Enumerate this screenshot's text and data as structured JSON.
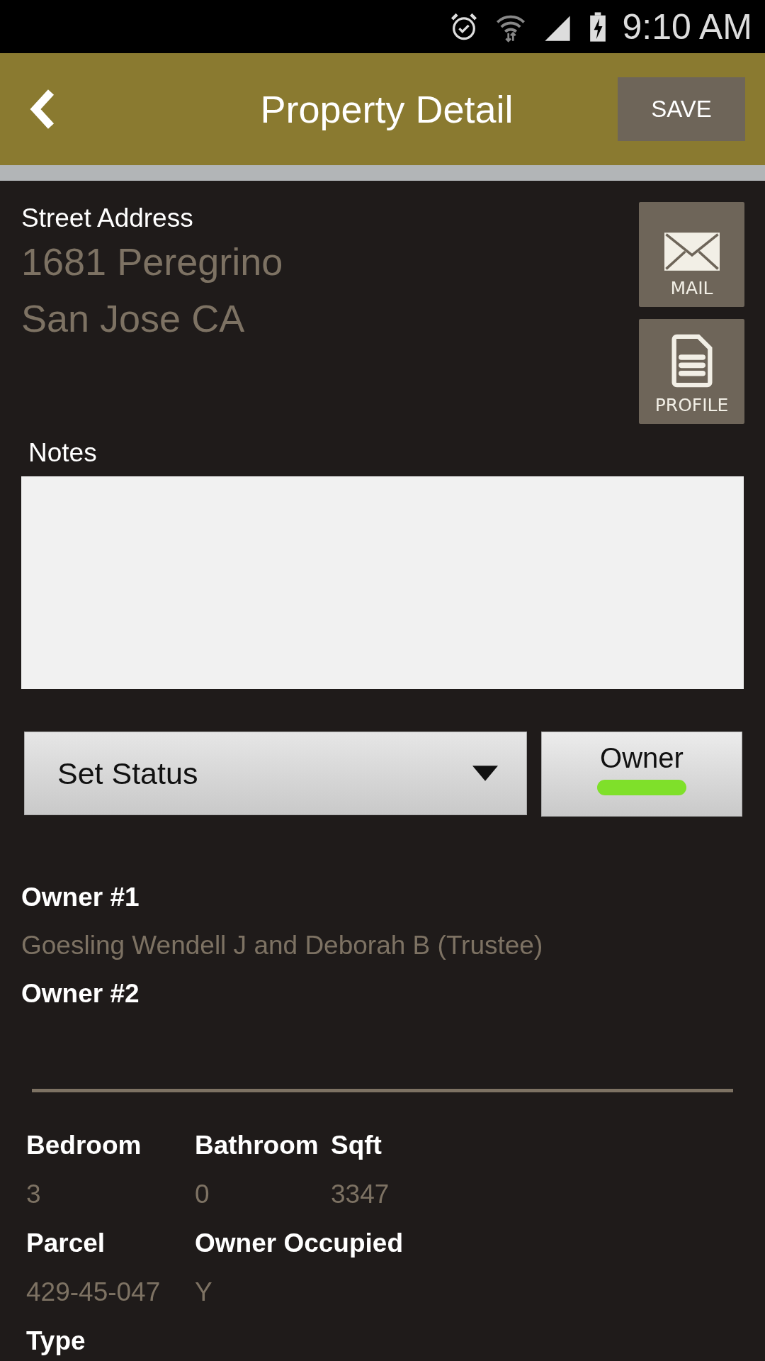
{
  "status_bar": {
    "time": "9:10 AM"
  },
  "header": {
    "title": "Property Detail",
    "save_label": "SAVE"
  },
  "address": {
    "label": "Street Address",
    "lines": [
      "1681 Peregrino",
      "San Jose CA"
    ]
  },
  "side_buttons": [
    {
      "kind": "mail",
      "label": "MAIL"
    },
    {
      "kind": "profile",
      "label": "PROFILE"
    }
  ],
  "notes": {
    "label": "Notes"
  },
  "status_dropdown": {
    "value": "Set Status"
  },
  "owner_toggle": {
    "label": "Owner",
    "on": true
  },
  "owners": [
    {
      "label": "Owner #1",
      "value": "Goesling Wendell J and Deborah B (Trustee)"
    },
    {
      "label": "Owner #2"
    }
  ],
  "details": [
    [
      {
        "label": "Bedroom",
        "value": "3"
      },
      {
        "label": "Bathroom",
        "value": "0"
      },
      {
        "label": "Sqft",
        "value": "3347"
      }
    ],
    [
      {
        "label": "Parcel",
        "value": "429-45-047"
      },
      {
        "label": "Owner Occupied",
        "value": "Y"
      }
    ],
    [
      {
        "label": "Type"
      }
    ]
  ]
}
